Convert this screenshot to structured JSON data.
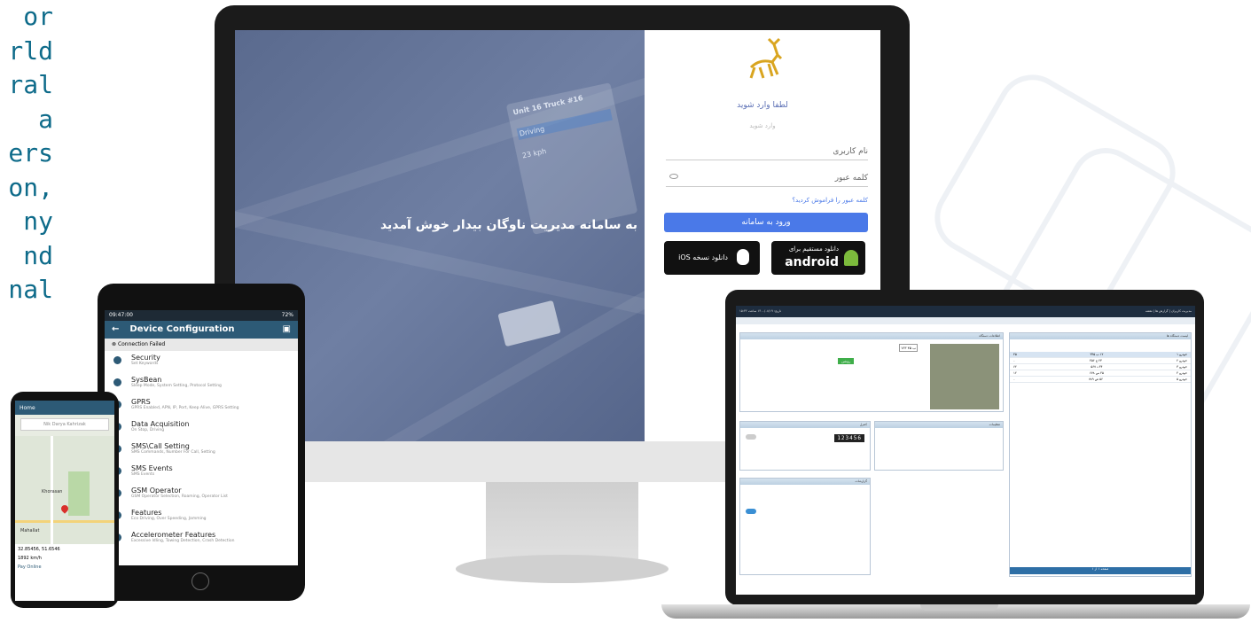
{
  "left_text": [
    "or",
    "rld",
    "ral",
    "a",
    "ers",
    "on,",
    "ny",
    "nd",
    "nal"
  ],
  "monitor": {
    "welcome": "به سامانه مدیریت ناوگان بیدار خوش آمدید",
    "map_label1": "Unit 16 Truck #16",
    "map_label2": "Driving",
    "map_label3": "23 kph",
    "login": {
      "title": "لطفا وارد شوید",
      "subtitle": "وارد شوید",
      "username": "نام کاربری",
      "password": "کلمه عبور",
      "forgot": "کلمه عبور را فراموش کردید؟",
      "button": "ورود به سامانه",
      "android_line1": "دانلود مستقیم برای",
      "android_line2": "android",
      "ios_label": "دانلود نسخه iOS"
    }
  },
  "tablet": {
    "status": "09:47:00",
    "battery": "72%",
    "title": "Device Configuration",
    "connection": "Connection Failed",
    "items": [
      {
        "title": "Security",
        "sub": "Set Keywords",
        "icon": "shield-icon"
      },
      {
        "title": "SysBean",
        "sub": "Sleep Mode, System Setting, Protocol Setting",
        "icon": "gear-icon"
      },
      {
        "title": "GPRS",
        "sub": "GPRS Enabled, APN, IP, Port, Keep Alive, GPRS Setting",
        "icon": "globe-icon"
      },
      {
        "title": "Data Acquisition",
        "sub": "On Stop, Driving",
        "icon": "chart-icon"
      },
      {
        "title": "SMS\\Call Setting",
        "sub": "SMS Commands, Number For Call, Setting",
        "icon": "message-icon"
      },
      {
        "title": "SMS Events",
        "sub": "SMS Events",
        "icon": "envelope-icon"
      },
      {
        "title": "GSM Operator",
        "sub": "GSM Operator Selection, Roaming, Operator List",
        "icon": "signal-icon"
      },
      {
        "title": "Features",
        "sub": "Eco Driving, Over Speeding, Jamming",
        "icon": "wrench-icon"
      },
      {
        "title": "Accelerometer Features",
        "sub": "Excessive Idling, Towing Detection, Crash Detection",
        "icon": "sensor-icon"
      }
    ]
  },
  "phone": {
    "title": "Home",
    "search": "Nik Darya Kahrizak",
    "place1": "Khorasan",
    "place2": "Mahallat",
    "info1": "32.85456, 51.6546",
    "info2": "1892 km/h",
    "info3": "Pay Online"
  },
  "laptop": {
    "topbar_left": "تاریخ: ۱۴۰۰/۰۸/۱۹ ساعت ۱۵:۳۲",
    "topbar_right": "مدیریت کاربران | گزارش ها | نقشه",
    "panel_map": "نقشه",
    "panel_info": "اطلاعات دستگاه",
    "panel_vehicles": "لیست دستگاه ها",
    "panel_controls": "کنترل",
    "panel_settings": "تنظیمات",
    "panel_reports": "گزارشات",
    "status_on": "روشن",
    "plate": "۱۲۳ ب ۴۵",
    "odometer": "123456",
    "rows": [
      {
        "name": "خودرو ۱",
        "plate": "۱۲ ب ۳۴۵",
        "speed": "۴۵"
      },
      {
        "name": "خودرو ۲",
        "plate": "۲۳ ج ۴۵۶",
        "speed": "۰"
      },
      {
        "name": "خودرو ۳",
        "plate": "۳۴ د ۵۶۷",
        "speed": "۶۲"
      },
      {
        "name": "خودرو ۴",
        "plate": "۴۵ س ۶۷۸",
        "speed": "۱۲"
      },
      {
        "name": "خودرو ۵",
        "plate": "۵۶ ص ۷۸۹",
        "speed": "۰"
      }
    ],
    "footer": "صفحه ۱ از ۱"
  }
}
